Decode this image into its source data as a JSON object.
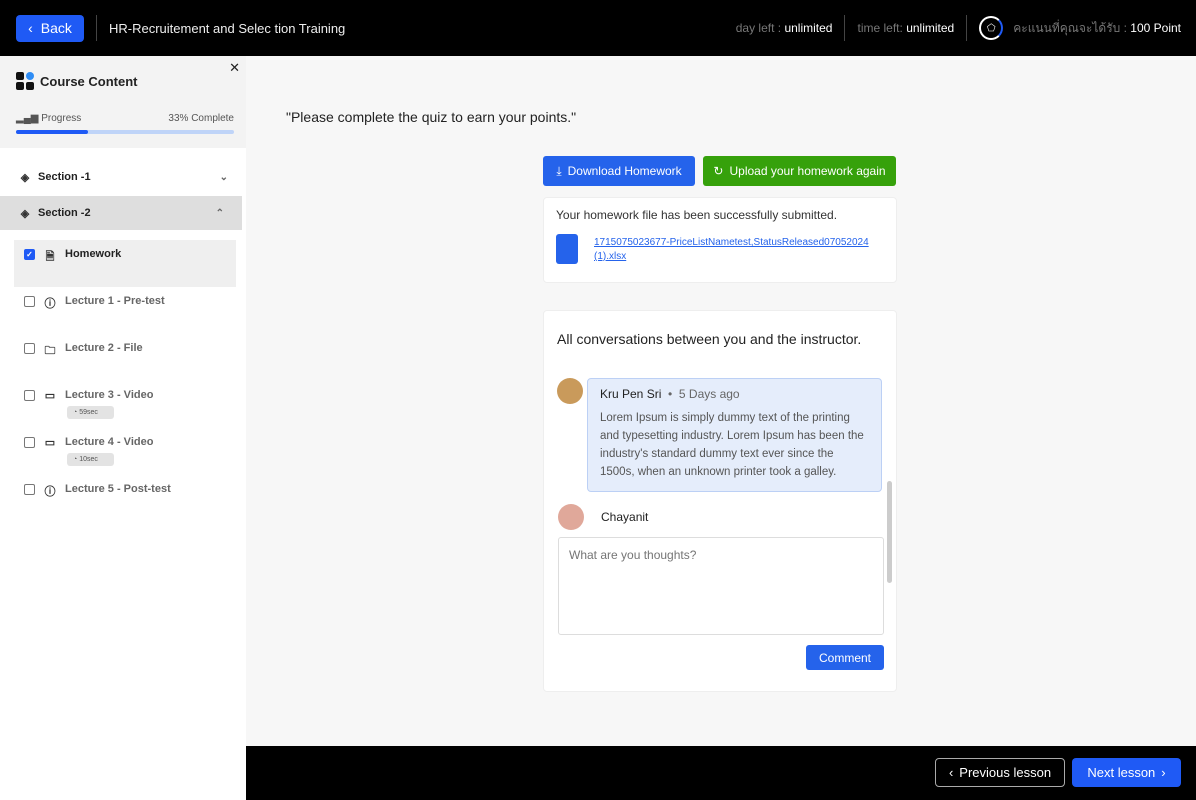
{
  "header": {
    "back": "Back",
    "course_title": "HR-Recruitement and Selec tion Training",
    "day_left_label": "day left :",
    "day_left_value": "unlimited",
    "time_left_label": "time left:",
    "time_left_value": "unlimited",
    "points_label": "คะแนนที่คุณจะได้รับ :",
    "points_value": "100 Point"
  },
  "sidebar": {
    "title": "Course Content",
    "progress_label": "Progress",
    "progress_text": "33% Complete",
    "progress": 33,
    "sections": [
      {
        "label": "Section -1"
      },
      {
        "label": "Section -2"
      }
    ],
    "items": [
      {
        "label": "Homework",
        "checked": true
      },
      {
        "label": "Lecture 1 - Pre-test"
      },
      {
        "label": "Lecture 2 - File"
      },
      {
        "label": "Lecture 3 - Video",
        "duration": "59sec"
      },
      {
        "label": "Lecture 4 - Video",
        "duration": "10sec"
      },
      {
        "label": "Lecture 5 - Post-test"
      }
    ]
  },
  "main": {
    "quiz_note": "\"Please complete the quiz to earn your points.\"",
    "download": "Download Homework",
    "upload": "Upload your homework again",
    "submitted": "Your homework file has been successfully submitted.",
    "file_name": "1715075023677-PriceListNametest,StatusReleased07052024 (1).xlsx",
    "conv_title": "All conversations between you and the instructor.",
    "comment": {
      "author": "Kru Pen Sri",
      "time": "5 Days ago",
      "text": "Lorem Ipsum is simply dummy text of the printing and typesetting industry. Lorem Ipsum has been the industry's standard dummy text ever since the 1500s, when an unknown printer took a galley."
    },
    "user": "Chayanit",
    "placeholder": "What are you thoughts?",
    "comment_btn": "Comment"
  },
  "footer": {
    "prev": "Previous lesson",
    "next": "Next lesson"
  }
}
